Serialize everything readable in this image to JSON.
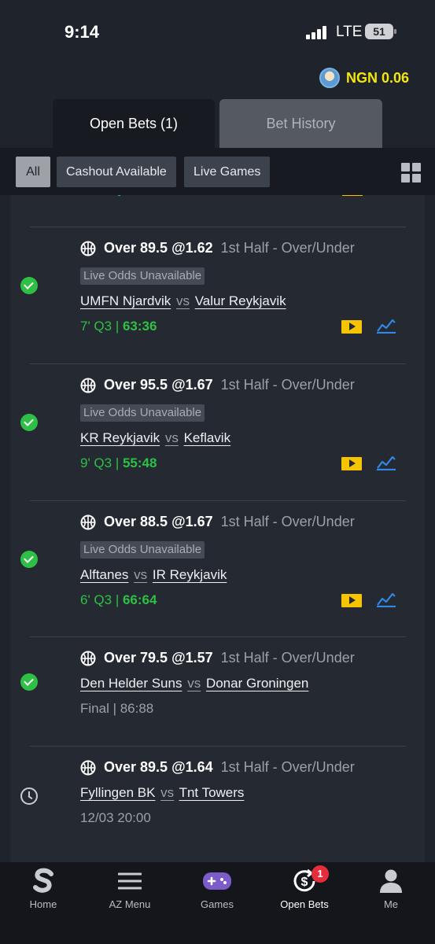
{
  "status_bar": {
    "time": "9:14",
    "network": "LTE",
    "battery": "51"
  },
  "balance": {
    "text": "NGN 0.06"
  },
  "tabs": [
    {
      "label": "Open Bets (1)",
      "active": true
    },
    {
      "label": "Bet History",
      "active": false
    }
  ],
  "filters": [
    {
      "label": "All",
      "active": true
    },
    {
      "label": "Cashout Available",
      "active": false
    },
    {
      "label": "Live Games",
      "active": false
    }
  ],
  "bets": [
    {
      "selection": "Over 89.5 @1.62",
      "market": "1st Half  -  Over/Under",
      "badge": "Live Odds Unavailable",
      "home": "UMFN Njardvik",
      "vs": "vs",
      "away": "Valur Reykjavik",
      "period": "7' Q3 | ",
      "score": "63:36",
      "state": "won"
    },
    {
      "selection": "Over 95.5 @1.67",
      "market": "1st Half  -  Over/Under",
      "badge": "Live Odds Unavailable",
      "home": "KR Reykjavik",
      "vs": "vs",
      "away": "Keflavik",
      "period": "9' Q3 | ",
      "score": "55:48",
      "state": "won"
    },
    {
      "selection": "Over 88.5 @1.67",
      "market": "1st Half  -  Over/Under",
      "badge": "Live Odds Unavailable",
      "home": "Alftanes",
      "vs": "vs",
      "away": "IR Reykjavik",
      "period": "6' Q3 | ",
      "score": "66:64",
      "state": "won"
    },
    {
      "selection": "Over 79.5 @1.57",
      "market": "1st Half  -  Over/Under",
      "home": "Den Helder Suns",
      "vs": "vs",
      "away": "Donar Groningen",
      "result": "Final | 86:88",
      "state": "won"
    },
    {
      "selection": "Over 89.5 @1.64",
      "market": "1st Half  -  Over/Under",
      "home": "Fyllingen BK",
      "vs": "vs",
      "away": "Tnt Towers",
      "kickoff": "12/03 20:00",
      "state": "pending"
    }
  ],
  "nav": [
    {
      "label": "Home",
      "icon": "sportybet-logo-icon"
    },
    {
      "label": "AZ Menu",
      "icon": "menu-icon"
    },
    {
      "label": "Games",
      "icon": "gamepad-icon"
    },
    {
      "label": "Open Bets",
      "icon": "open-bets-icon",
      "badge": "1",
      "active": true
    },
    {
      "label": "Me",
      "icon": "user-icon"
    }
  ],
  "colors": {
    "accent_green": "#2ec045",
    "balance_yellow": "#f5e70e",
    "notif_red": "#e52d3b",
    "tv_yellow": "#f7c400",
    "trend_blue": "#2f89e8"
  }
}
